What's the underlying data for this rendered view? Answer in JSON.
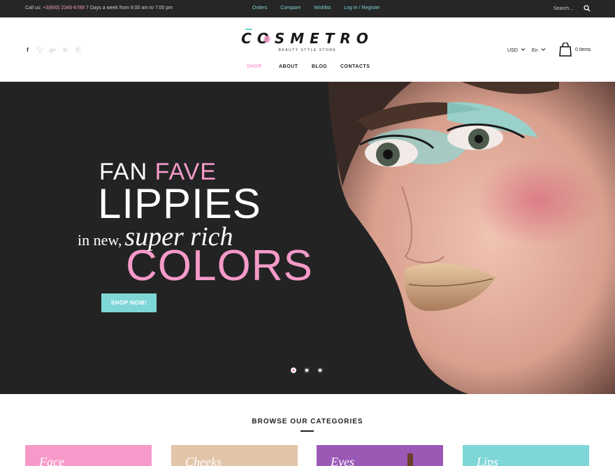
{
  "topbar": {
    "call_label": "Call us:",
    "phone": "+3(800) 2345-6789",
    "hours": "7 Days a week from 9:00 am to 7:00 pm",
    "links": [
      "Orders",
      "Compare",
      "Wishlist",
      "Log In / Register"
    ],
    "search_placeholder": "Search..."
  },
  "header": {
    "logo_text": "COSMETRO",
    "logo_tagline": "BEAUTY STYLE STORE",
    "nav": [
      "SHOP",
      "ABOUT",
      "BLOG",
      "CONTACTS"
    ],
    "active_nav": "SHOP",
    "currency": "USD",
    "language": "En",
    "cart_label": "0 items",
    "social_icons": [
      "facebook-icon",
      "twitter-icon",
      "google-plus-icon",
      "linkedin-icon",
      "pinterest-icon"
    ]
  },
  "hero": {
    "line1_a": "FAN",
    "line1_b": "FAVE",
    "line2": "LIPPIES",
    "line3_a": "in new,",
    "line3_b": "super rich",
    "line4": "COLORS",
    "button": "SHOP NOW!",
    "slides": 3,
    "active_slide": 1
  },
  "categories": {
    "heading": "BROWSE OUR CATEGORIES",
    "items": [
      {
        "label": "Face",
        "color": "#f79ac9"
      },
      {
        "label": "Cheeks",
        "color": "#e2c4a8"
      },
      {
        "label": "Eyes",
        "color": "#9b59b6"
      },
      {
        "label": "Lips",
        "color": "#7fd6d6"
      }
    ]
  },
  "colors": {
    "accent_pink": "#f59ac9",
    "accent_teal": "#7fd6d6",
    "dark": "#232323"
  }
}
